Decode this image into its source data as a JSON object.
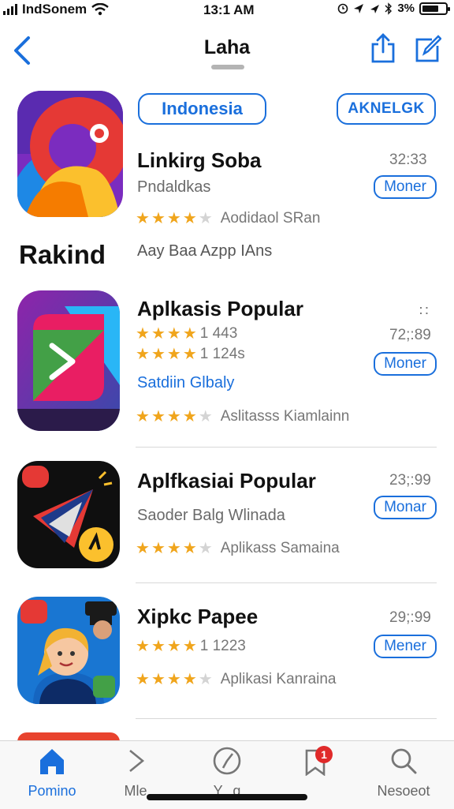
{
  "status": {
    "carrier": "IndSonem",
    "time": "13:1 AM",
    "battery": "3%"
  },
  "nav": {
    "title": "Laha"
  },
  "filters": {
    "primary": "Indonesia",
    "secondary": "AKNELGK"
  },
  "featured": {
    "title": "Linkirg Soba",
    "subtitle": "Pndaldkas",
    "size": "32:33",
    "button": "Moner",
    "rating_count": "Aodidaol SRan",
    "caption": "Aay Baa Azpp IAns",
    "brand": "Rakind",
    "rating": 4
  },
  "apps": [
    {
      "title": "Aplkasis Popular",
      "rating1": "1 443",
      "rating2": "1 124s",
      "link": "Satdiin Glbaly",
      "size": "72;:89",
      "button": "Moner",
      "caption": "Aslitasss Kiamlainn",
      "more": "∷"
    },
    {
      "title": "Aplfkasiai Popular",
      "subtitle": "Saoder Balg Wlinada",
      "size": "23;:99",
      "button": "Monar",
      "caption": "Aplikass Samaina"
    },
    {
      "title": "Xipkc Papee",
      "rating1": "1 1223",
      "size": "29;:99",
      "button": "Mener",
      "caption": "Aplikasi Kanraina"
    }
  ],
  "tabs": [
    {
      "label": "Pomino",
      "icon": "home-icon",
      "active": true
    },
    {
      "label": "Mle",
      "icon": "chevron-right-icon"
    },
    {
      "label": "Y...g",
      "icon": "clock-icon"
    },
    {
      "label": "",
      "icon": "bookmark-icon",
      "badge": "1"
    },
    {
      "label": "Nesoeot",
      "icon": "search-icon"
    }
  ],
  "colors": {
    "accent": "#1a6fdc",
    "star": "#f0a51c",
    "badge": "#e02a2a"
  }
}
